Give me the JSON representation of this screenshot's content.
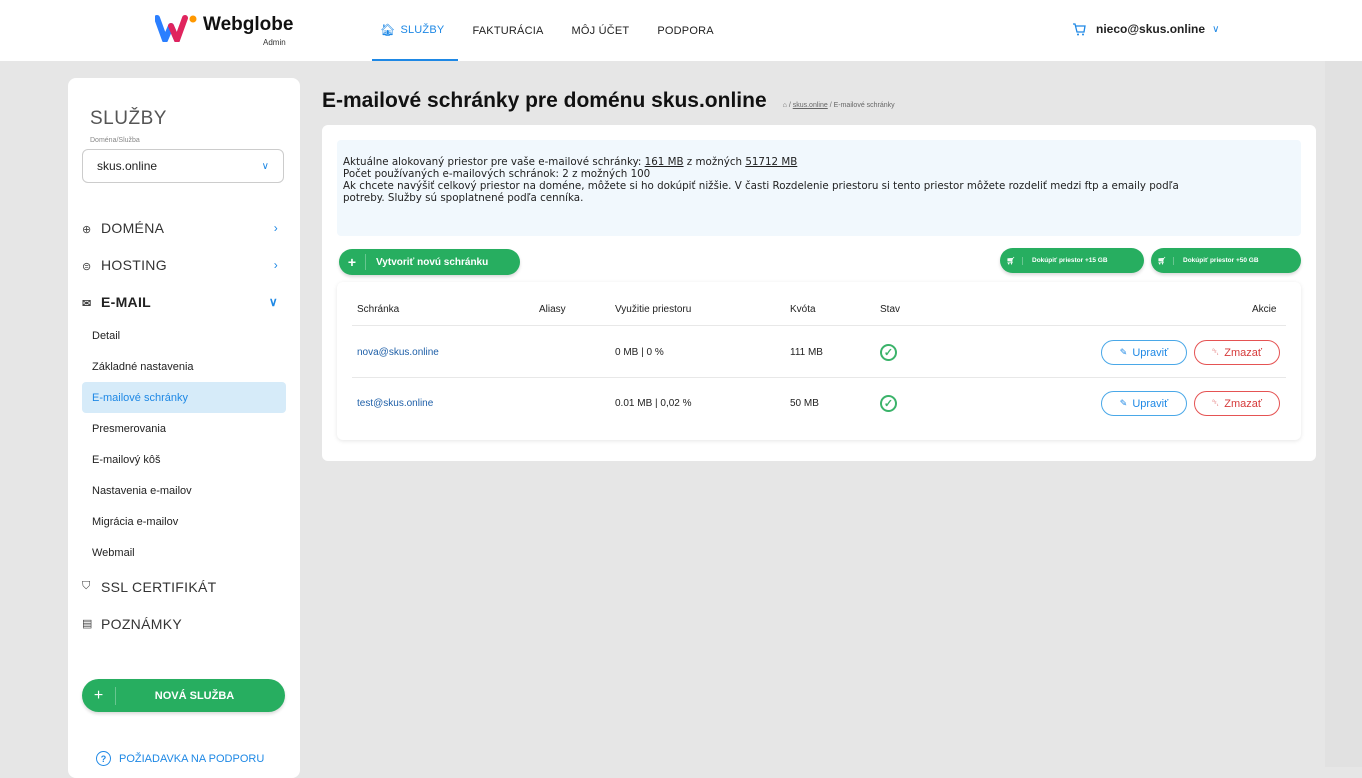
{
  "brand": {
    "name": "Webglobe",
    "sub": "Admin"
  },
  "nav": {
    "items": [
      {
        "label": "SLUŽBY",
        "active": true
      },
      {
        "label": "FAKTURÁCIA",
        "active": false
      },
      {
        "label": "MÔJ ÚČET",
        "active": false
      },
      {
        "label": "PODPORA",
        "active": false
      }
    ],
    "account": "nieco@skus.online"
  },
  "sidebar": {
    "title": "SLUŽBY",
    "subtitle": "Doména/Služba",
    "selected_domain": "skus.online",
    "sections": [
      {
        "label": "DOMÉNA",
        "icon": "globe-icon"
      },
      {
        "label": "HOSTING",
        "icon": "server-icon"
      },
      {
        "label": "E-MAIL",
        "icon": "envelope-icon"
      }
    ],
    "email_items": [
      "Detail",
      "Základné nastavenia",
      "E-mailové schránky",
      "Presmerovania",
      "E-mailový kôš",
      "Nastavenia e-mailov",
      "Migrácia e-mailov",
      "Webmail"
    ],
    "active_item": "E-mailové schránky",
    "ssl_label": "SSL CERTIFIKÁT",
    "notes_label": "POZNÁMKY",
    "new_service": "NOVÁ SLUŽBA",
    "support": "POŽIADAVKA NA PODPORU"
  },
  "page": {
    "title": "E-mailové schránky pre doménu skus.online",
    "breadcrumb_link": "skus.online",
    "breadcrumb_current": "E-mailové schránky"
  },
  "info": {
    "line1_pre": "Aktuálne alokovaný priestor pre vaše e-mailové schránky: ",
    "allocated": "161 MB",
    "line1_mid": " z možných ",
    "possible": "51712 MB",
    "line2": "Počet používaných e-mailových schránok: 2 z možných 100",
    "line3": "Ak chcete navýšiť celkový priestor na doméne, môžete si ho dokúpiť nižšie. V časti Rozdelenie priestoru si tento priestor môžete rozdeliť medzi ftp a emaily podľa",
    "line4": "potreby. Služby sú spoplatnené podľa cenníka."
  },
  "actions": {
    "create": "Vytvoriť novú schránku",
    "buy15": "Dokúpiť priestor +15 GB",
    "buy50": "Dokúpiť priestor +50 GB"
  },
  "table": {
    "headers": {
      "mailbox": "Schránka",
      "aliases": "Aliasy",
      "usage": "Využitie priestoru",
      "quota": "Kvóta",
      "status": "Stav",
      "actions": "Akcie"
    },
    "rows": [
      {
        "mailbox": "nova@skus.online",
        "aliases": "",
        "usage": "0 MB | 0 %",
        "quota": "111 MB",
        "status": "ok"
      },
      {
        "mailbox": "test@skus.online",
        "aliases": "",
        "usage": "0.01 MB | 0,02 %",
        "quota": "50 MB",
        "status": "ok"
      }
    ],
    "edit_label": "Upraviť",
    "delete_label": "Zmazať"
  },
  "colors": {
    "accent": "#1e88e5",
    "green": "#27ae60",
    "danger": "#d63a3a"
  }
}
